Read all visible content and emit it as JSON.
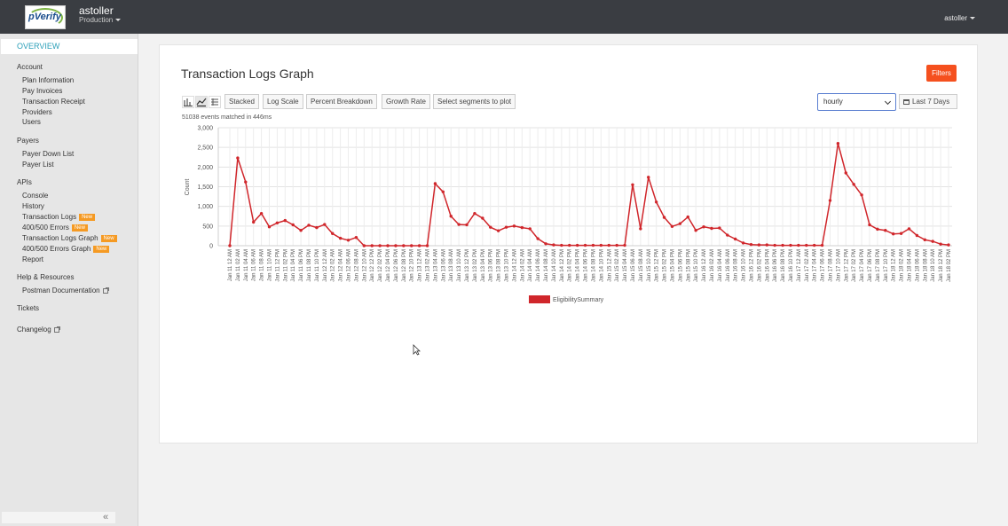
{
  "header": {
    "logo_text": "pVerify",
    "account": "astoller",
    "environment": "Production",
    "user": "astoller"
  },
  "sidebar": {
    "overview": "OVERVIEW",
    "sections": [
      {
        "title": "Account",
        "items": [
          {
            "label": "Plan Information"
          },
          {
            "label": "Pay Invoices"
          },
          {
            "label": "Transaction Receipt"
          },
          {
            "label": "Providers"
          },
          {
            "label": "Users"
          }
        ]
      },
      {
        "title": "Payers",
        "items": [
          {
            "label": "Payer Down List"
          },
          {
            "label": "Payer List"
          }
        ]
      },
      {
        "title": "APIs",
        "items": [
          {
            "label": "Console"
          },
          {
            "label": "History"
          },
          {
            "label": "Transaction Logs",
            "badge": "New"
          },
          {
            "label": "400/500 Errors",
            "badge": "New"
          },
          {
            "label": "Transaction Logs Graph",
            "badge": "New"
          },
          {
            "label": "400/500 Errors Graph",
            "badge": "New"
          },
          {
            "label": "Report"
          }
        ]
      },
      {
        "title": "Help & Resources",
        "items": [
          {
            "label": "Postman Documentation"
          }
        ]
      }
    ],
    "tickets": "Tickets",
    "changelog": "Changelog",
    "collapse": "«"
  },
  "panel": {
    "title": "Transaction Logs Graph",
    "filters": "Filters",
    "toolbar": {
      "stacked": "Stacked",
      "log_scale": "Log Scale",
      "percent": "Percent Breakdown",
      "growth": "Growth Rate",
      "segments": "Select segments to plot"
    },
    "interval": "hourly",
    "range": "Last 7 Days",
    "meta": "51038 events matched in 446ms"
  },
  "chart_data": {
    "type": "line",
    "title": "",
    "xlabel": "",
    "ylabel": "Count",
    "ylim": [
      0,
      3000
    ],
    "yticks": [
      "0",
      "500",
      "1,000",
      "1,500",
      "2,000",
      "2,500",
      "3,000"
    ],
    "x_start": "Jan 11 12 AM",
    "x_step_hours": 2,
    "x_count": 92,
    "series": [
      {
        "name": "EligibilitySummary",
        "color": "#d0262b",
        "values": [
          0,
          2230,
          1620,
          600,
          820,
          480,
          580,
          640,
          530,
          390,
          520,
          460,
          540,
          310,
          190,
          140,
          210,
          0,
          0,
          0,
          0,
          0,
          0,
          0,
          0,
          0,
          1580,
          1370,
          750,
          540,
          530,
          820,
          700,
          470,
          380,
          470,
          500,
          460,
          430,
          180,
          50,
          20,
          10,
          10,
          10,
          10,
          10,
          10,
          10,
          10,
          10,
          1550,
          430,
          1740,
          1110,
          720,
          490,
          560,
          730,
          390,
          480,
          440,
          450,
          270,
          170,
          70,
          30,
          20,
          20,
          10,
          10,
          10,
          10,
          10,
          10,
          10,
          1150,
          2600,
          1850,
          1560,
          1290,
          530,
          420,
          390,
          300,
          310,
          430,
          260,
          150,
          110,
          40,
          20
        ]
      }
    ]
  }
}
